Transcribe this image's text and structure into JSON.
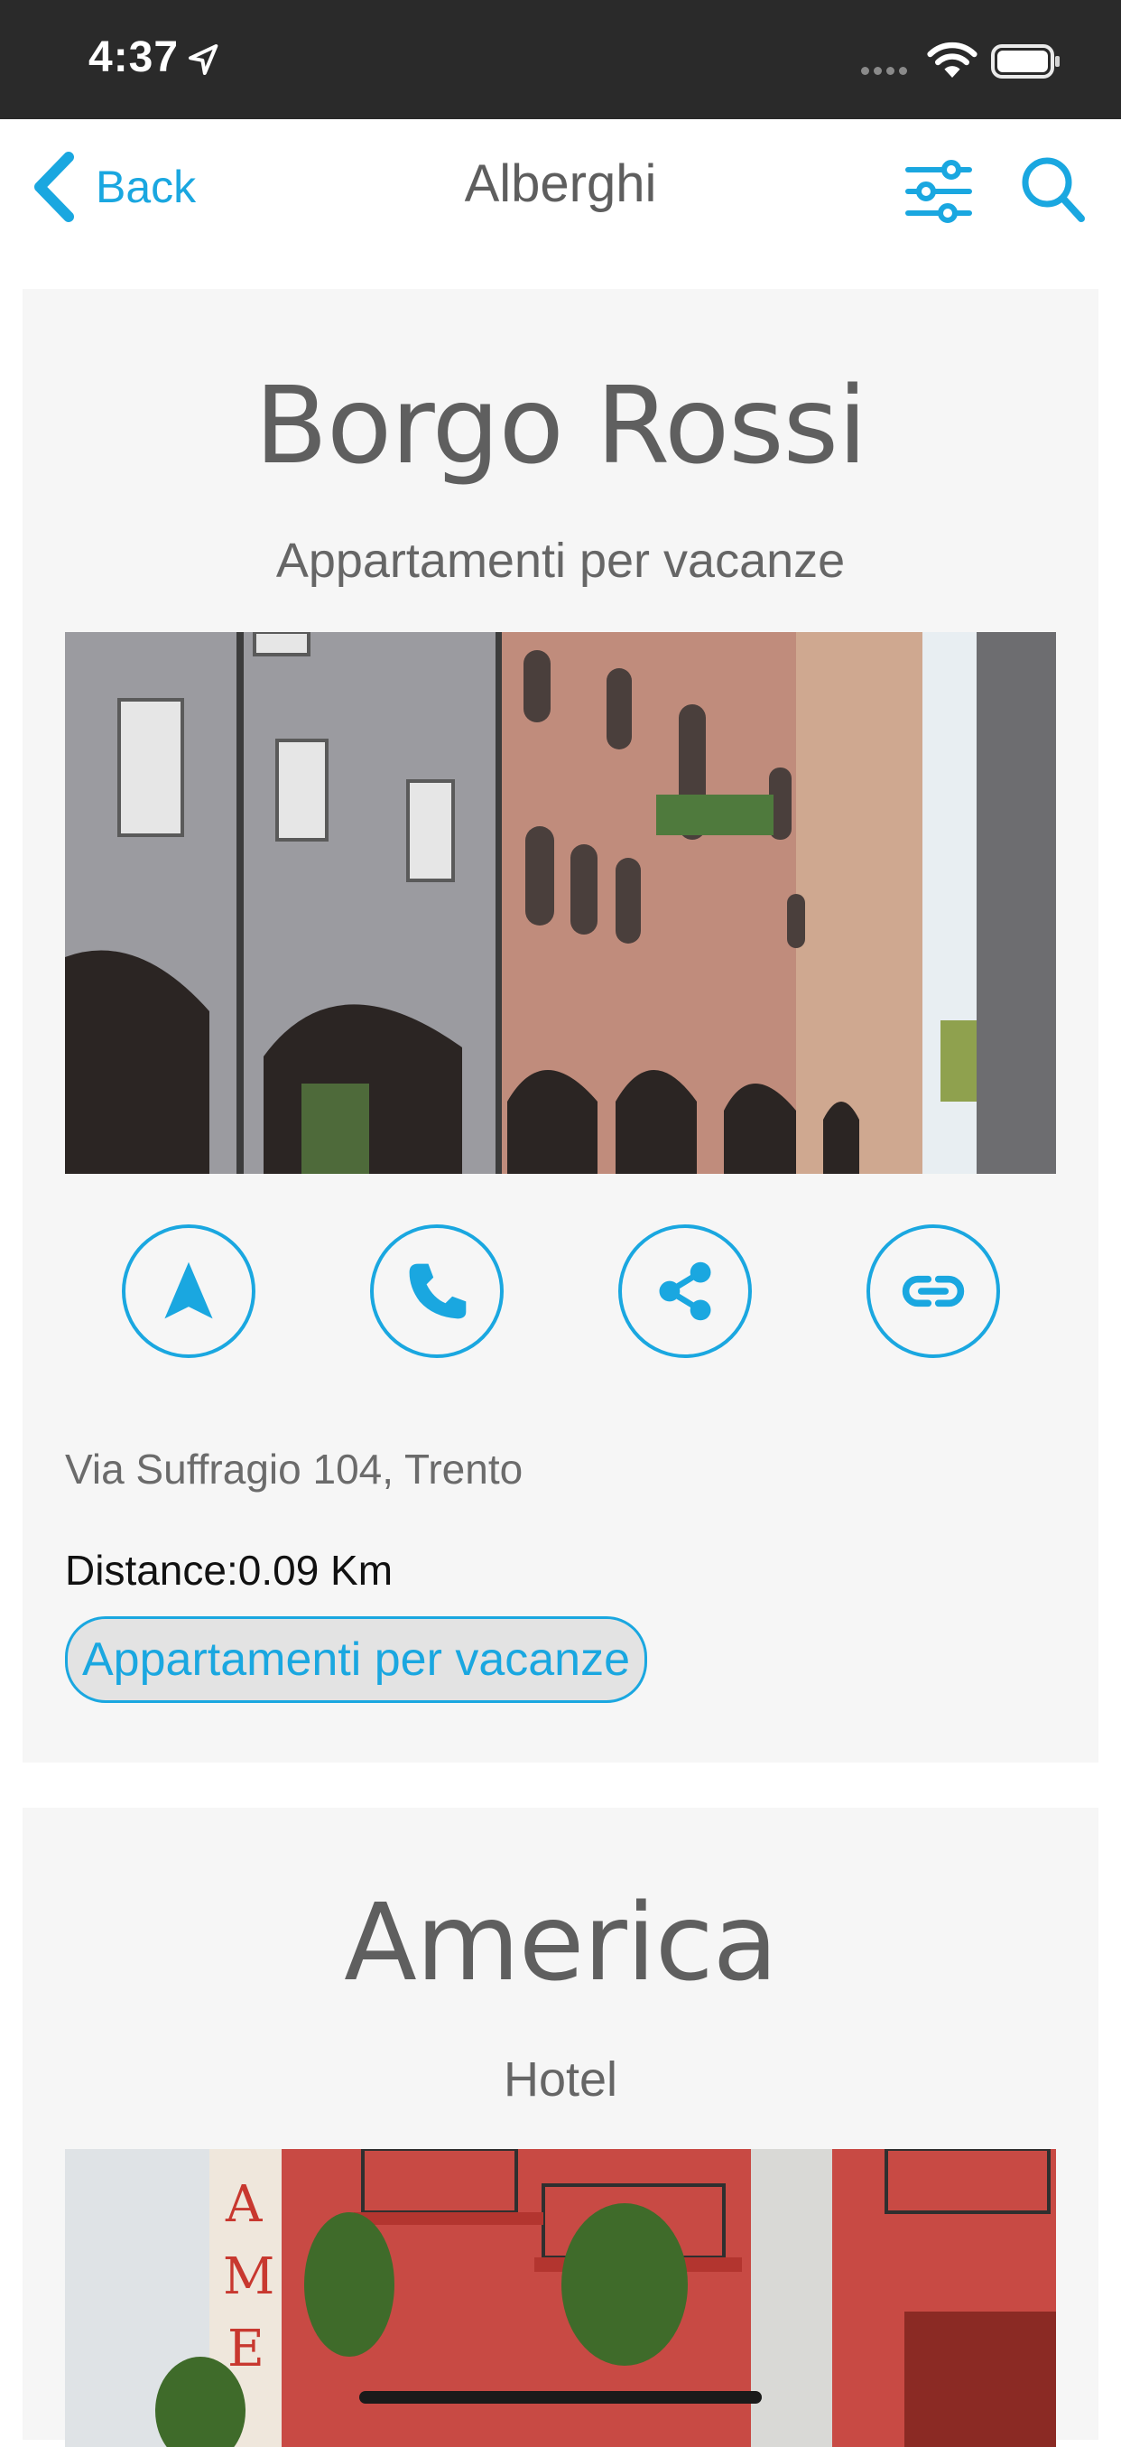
{
  "status_bar": {
    "time": "4:37",
    "icons": [
      "location-arrow-icon",
      "cellular-signal-icon",
      "wifi-icon",
      "battery-icon"
    ]
  },
  "nav": {
    "back_label": "Back",
    "title": "Alberghi",
    "filter_icon": "sliders-icon",
    "search_icon": "search-icon"
  },
  "colors": {
    "accent": "#1aa7e0",
    "card_background": "#f6f6f6",
    "status_bar": "#2a2a2a",
    "title_text": "#5f5f5f"
  },
  "listings": [
    {
      "name": "Borgo Rossi",
      "type": "Appartamenti per vacanze",
      "photo": "building-facade-arcades-photo",
      "actions": [
        "navigate-icon",
        "phone-icon",
        "share-icon",
        "link-icon"
      ],
      "address": "Via Suffragio 104, Trento",
      "distance": "Distance:0.09 Km",
      "category_tag": "Appartamenti per vacanze"
    },
    {
      "name": "America",
      "type": "Hotel",
      "photo": "red-hotel-facade-balconies-photo"
    }
  ]
}
